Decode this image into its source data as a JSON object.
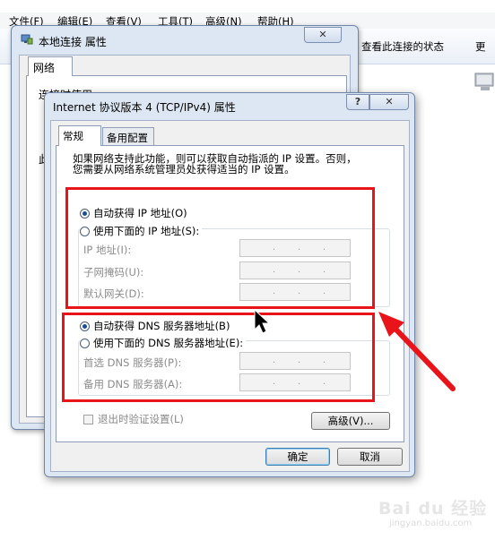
{
  "explorer": {
    "menu": [
      "文件(F)",
      "编辑(E)",
      "查看(V)",
      "工具(T)",
      "高级(N)",
      "帮助(H)"
    ],
    "command_status": "查看此连接的状态",
    "command_more": "更"
  },
  "back_dialog": {
    "title": "本地连接 属性",
    "close": "✕",
    "tab": "网络",
    "line1": "连接时使用:",
    "line2": "此"
  },
  "dialog": {
    "title": "Internet 协议版本 4 (TCP/IPv4) 属性",
    "help_btn": "?",
    "close_btn": "✕",
    "tabs": [
      "常规",
      "备用配置"
    ],
    "description_line1": "如果网络支持此功能，则可以获取自动指派的 IP 设置。否则，",
    "description_line2": "您需要从网络系统管理员处获得适当的 IP 设置。",
    "ip_auto": "自动获得 IP 地址(O)",
    "ip_manual": "使用下面的 IP 地址(S):",
    "ip_address_label": "IP 地址(I):",
    "subnet_label": "子网掩码(U):",
    "gateway_label": "默认网关(D):",
    "dns_auto": "自动获得 DNS 服务器地址(B)",
    "dns_manual": "使用下面的 DNS 服务器地址(E):",
    "preferred_dns_label": "首选 DNS 服务器(P):",
    "alternate_dns_label": "备用 DNS 服务器(A):",
    "validate_label": "退出时验证设置(L)",
    "advanced_btn": "高级(V)...",
    "ok_btn": "确定",
    "cancel_btn": "取消",
    "ip_dots": "."
  },
  "watermark": {
    "text": "Bai du 经验",
    "sub": "jingyan.baidu.com"
  },
  "colors": {
    "highlight": "#e8141a",
    "accent": "#1b4d96"
  }
}
